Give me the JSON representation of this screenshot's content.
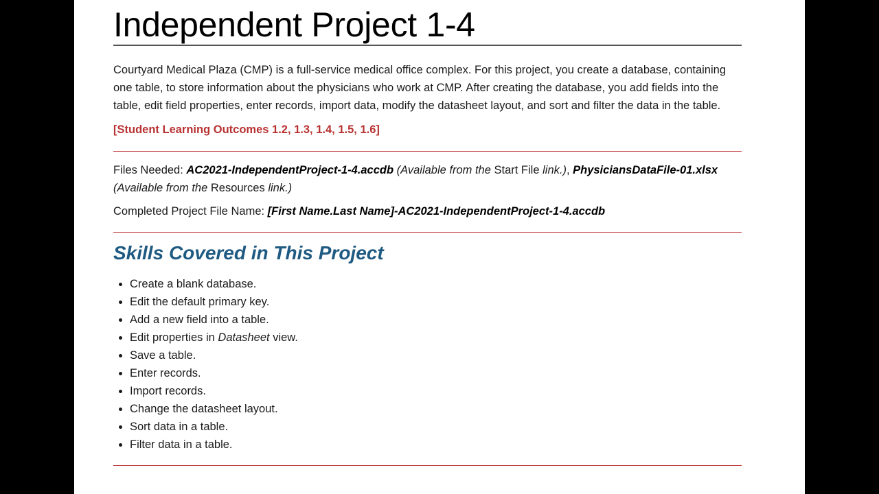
{
  "title": "Independent Project 1-4",
  "intro": "Courtyard Medical Plaza (CMP) is a full-service medical office complex. For this project, you create a database, containing one table, to store information about the physicians who work at CMP. After creating the database, you add fields into the table, edit field properties, enter records, import data, modify the datasheet layout, and sort and filter the data in the table.",
  "slo": "[Student Learning Outcomes 1.2, 1.3, 1.4, 1.5, 1.6]",
  "files": {
    "label": "Files Needed: ",
    "file1": "AC2021-IndependentProject-1-4.accdb",
    "file1_note_a": " (Available from the ",
    "file1_link": "Start File",
    "file1_note_b": " link.)",
    "sep": ", ",
    "file2": "PhysiciansDataFile-01.xlsx",
    "file2_note_a": " (Available from the ",
    "file2_link": "Resources",
    "file2_note_b": " link.)"
  },
  "completed": {
    "label": "Completed Project File Name: ",
    "value": "[First Name.Last Name]-AC2021-IndependentProject-1-4.accdb"
  },
  "skills": {
    "heading": "Skills Covered in This Project",
    "items": [
      {
        "text": "Create a blank database."
      },
      {
        "text": "Edit the default primary key."
      },
      {
        "text": "Add a new field into a table."
      },
      {
        "pre": "Edit properties in ",
        "em": "Datasheet",
        "post": " view."
      },
      {
        "text": "Save a table."
      },
      {
        "text": "Enter records."
      },
      {
        "text": "Import records."
      },
      {
        "text": "Change the datasheet layout."
      },
      {
        "text": "Sort data in a table."
      },
      {
        "text": "Filter data in a table."
      }
    ]
  }
}
